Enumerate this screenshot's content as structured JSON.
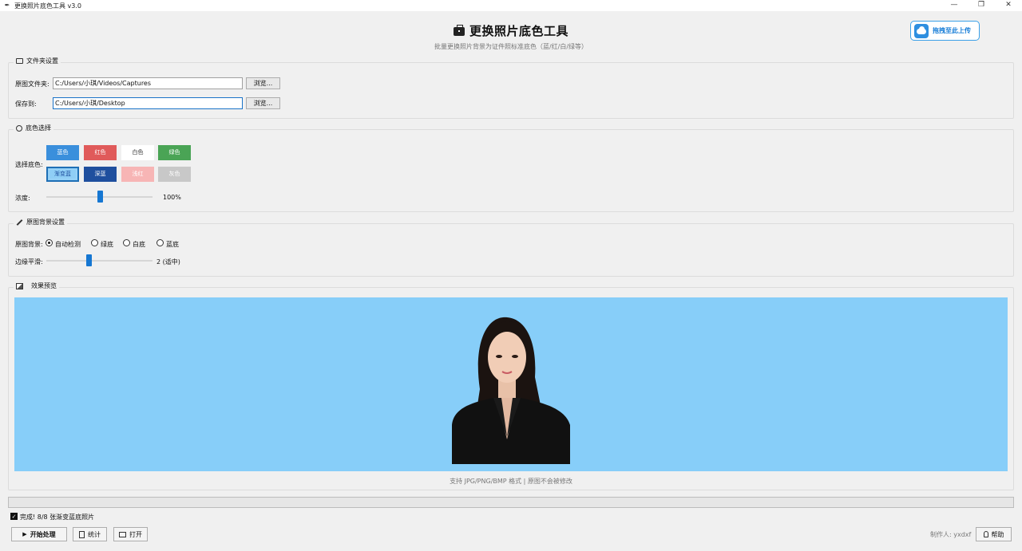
{
  "window": {
    "title": "更换照片底色工具 v3.0",
    "controls": {
      "minimize": "—",
      "restore": "❐",
      "close": "✕"
    }
  },
  "header": {
    "title": "更换照片底色工具",
    "subtitle": "批量更换照片背景为证件照标准底色（蓝/红/白/绿等）",
    "upload_label": "拖拽至此上传"
  },
  "folder_settings": {
    "title": "文件夹设置",
    "source_label": "原图文件夹:",
    "source_value": "C:/Users/小琪/Videos/Captures",
    "save_label": "保存到:",
    "save_value": "C:/Users/小琪/Desktop",
    "browse_label": "浏览..."
  },
  "color_select": {
    "title": "底色选择",
    "choose_label": "选择底色:",
    "swatches": [
      {
        "label": "蓝色",
        "color": "#3a8fdc"
      },
      {
        "label": "红色",
        "color": "#e05a5a"
      },
      {
        "label": "白色",
        "color": "#ffffff"
      },
      {
        "label": "绿色",
        "color": "#4aa455"
      },
      {
        "label": "渐变蓝",
        "color": "#8fcef6"
      },
      {
        "label": "深蓝",
        "color": "#1f4f9e"
      },
      {
        "label": "浅红",
        "color": "#f7b5b5"
      },
      {
        "label": "灰色",
        "color": "#c8c8c8"
      }
    ],
    "selected": "渐变蓝",
    "intensity_label": "浓度:",
    "intensity_value": "100%",
    "intensity_fraction": 0.5
  },
  "original_bg": {
    "title": "原图背景设置",
    "bg_label": "原图背景:",
    "options": [
      "自动检测",
      "绿底",
      "白底",
      "蓝底"
    ],
    "selected": "自动检测",
    "smooth_label": "边缘平滑:",
    "smooth_value": "2 (适中)",
    "smooth_fraction": 0.4
  },
  "preview": {
    "title": "效果预览",
    "background_color": "#87cef9",
    "hint": "支持 JPG/PNG/BMP 格式 | 原图不会被修改"
  },
  "status": {
    "progress_fraction": 0,
    "message": "完成! 8/8 张渐变蓝底照片"
  },
  "bottom_bar": {
    "start_label": "开始处理",
    "stats_label": "统计",
    "open_label": "打开",
    "author": "制作人: yxdxf",
    "help_label": "帮助"
  }
}
